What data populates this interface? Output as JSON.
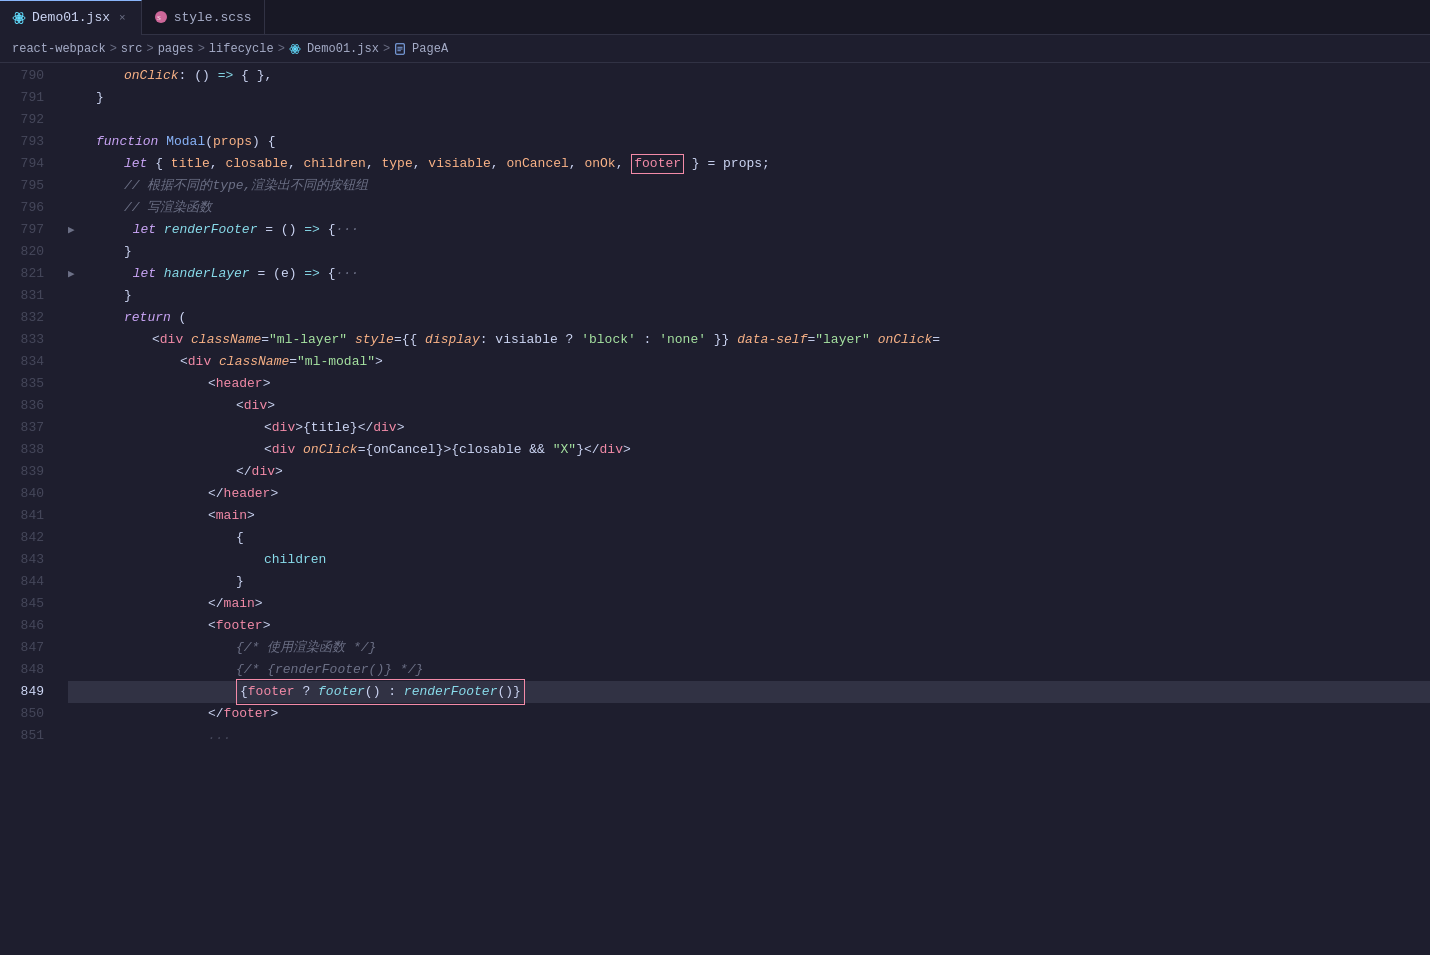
{
  "tabs": [
    {
      "id": "demo01",
      "label": "Demo01.jsx",
      "icon": "react-icon",
      "active": true,
      "closable": true
    },
    {
      "id": "style",
      "label": "style.scss",
      "icon": "sass-icon",
      "active": false,
      "closable": false
    }
  ],
  "breadcrumb": {
    "parts": [
      "react-webpack",
      "src",
      "pages",
      "lifecycle",
      "Demo01.jsx",
      "PageA"
    ]
  },
  "lines": {
    "start": 790,
    "items": [
      {
        "num": 790,
        "content": "onClick"
      },
      {
        "num": 791,
        "content": "close_brace"
      },
      {
        "num": 792,
        "content": "empty"
      },
      {
        "num": 793,
        "content": "function_modal"
      },
      {
        "num": 794,
        "content": "let_destructure"
      },
      {
        "num": 795,
        "content": "comment_type"
      },
      {
        "num": 796,
        "content": "comment_render"
      },
      {
        "num": 797,
        "content": "let_renderFooter",
        "folded": true
      },
      {
        "num": 820,
        "content": "close_brace2"
      },
      {
        "num": 821,
        "content": "let_handerLayer",
        "folded": true
      },
      {
        "num": 831,
        "content": "close_brace3"
      },
      {
        "num": 832,
        "content": "return_open"
      },
      {
        "num": 833,
        "content": "div_ml_layer"
      },
      {
        "num": 834,
        "content": "div_ml_modal"
      },
      {
        "num": 835,
        "content": "header_open"
      },
      {
        "num": 836,
        "content": "div_open"
      },
      {
        "num": 837,
        "content": "div_title"
      },
      {
        "num": 838,
        "content": "div_onclick_cancel"
      },
      {
        "num": 839,
        "content": "div_close"
      },
      {
        "num": 840,
        "content": "header_close"
      },
      {
        "num": 841,
        "content": "main_open"
      },
      {
        "num": 842,
        "content": "brace_open"
      },
      {
        "num": 843,
        "content": "children"
      },
      {
        "num": 844,
        "content": "brace_close"
      },
      {
        "num": 845,
        "content": "main_close"
      },
      {
        "num": 846,
        "content": "footer_open"
      },
      {
        "num": 847,
        "content": "comment_use"
      },
      {
        "num": 848,
        "content": "comment_renderFooter"
      },
      {
        "num": 849,
        "content": "footer_ternary",
        "highlighted": true
      },
      {
        "num": 850,
        "content": "footer_close"
      },
      {
        "num": 851,
        "content": "dots"
      }
    ]
  },
  "colors": {
    "bg": "#1e1e2e",
    "tab_bg": "#181825",
    "active_tab_border": "#89b4fa",
    "highlight_line": "#313244",
    "red_box": "#f38ba8"
  }
}
